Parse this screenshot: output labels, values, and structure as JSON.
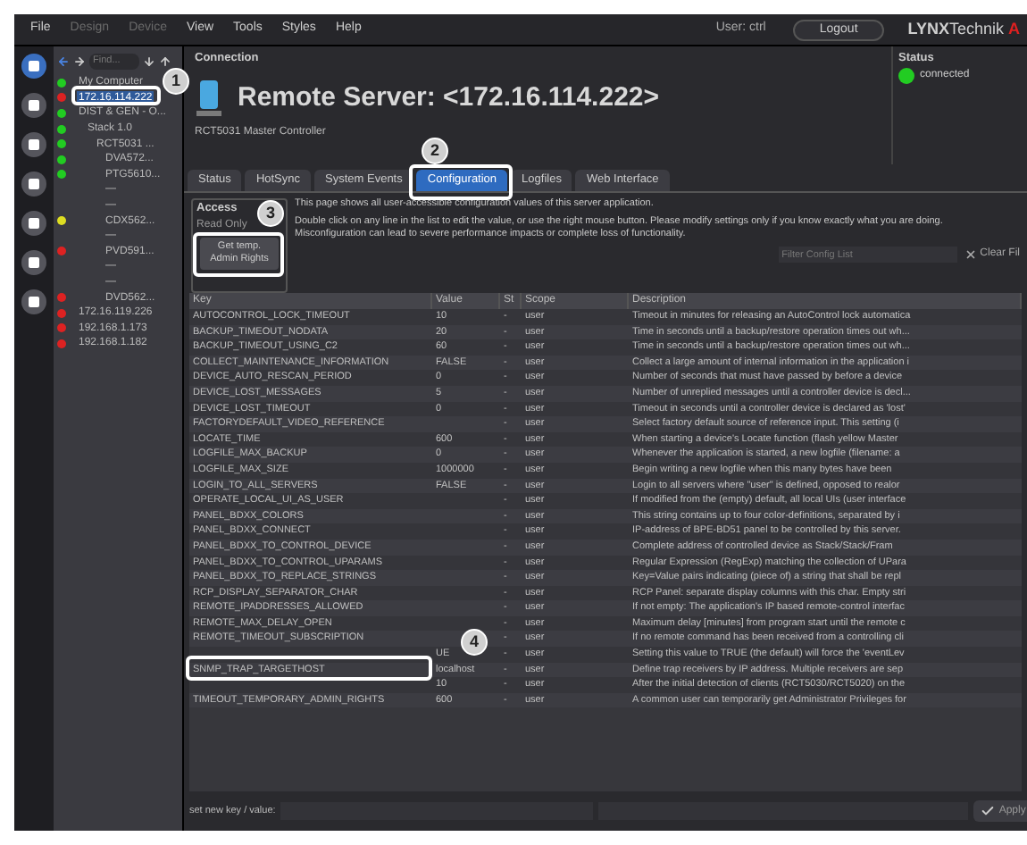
{
  "menu": [
    {
      "label": "File",
      "disabled": false
    },
    {
      "label": "Design",
      "disabled": true
    },
    {
      "label": "Device",
      "disabled": true
    },
    {
      "label": "View",
      "disabled": false
    },
    {
      "label": "Tools",
      "disabled": false
    },
    {
      "label": "Styles",
      "disabled": false
    },
    {
      "label": "Help",
      "disabled": false
    }
  ],
  "user": "User: ctrl",
  "logout": "Logout",
  "logo": {
    "bold": "LYNX",
    "rest": "Technik",
    "mark": "A"
  },
  "tree_nav": {
    "placeholder": "Find..."
  },
  "tree": [
    {
      "label": "My Computer",
      "color": "#22cc22",
      "selected": false
    },
    {
      "label": "172.16.114.222",
      "color": "#dd2222",
      "selected": true
    },
    {
      "label": "DIST & GEN - O...",
      "color": "#22cc22",
      "selected": false,
      "children": [
        {
          "label": "Stack 1.0",
          "color": "#22cc22",
          "selected": false,
          "children": [
            {
              "label": "RCT5031 ...",
              "color": "#22cc22",
              "selected": false,
              "children": [
                {
                  "label": "DVA572...",
                  "color": "#22cc22",
                  "selected": false
                },
                {
                  "label": "PTG5610...",
                  "color": "#22cc22",
                  "selected": false
                },
                {
                  "label": "—",
                  "selected": false
                },
                {
                  "label": "—",
                  "selected": false
                },
                {
                  "label": "CDX562...",
                  "color": "#dddd22",
                  "selected": false
                },
                {
                  "label": "—",
                  "selected": false
                },
                {
                  "label": "PVD591...",
                  "color": "#dd2222",
                  "selected": false
                },
                {
                  "label": "—",
                  "selected": false
                },
                {
                  "label": "—",
                  "selected": false
                },
                {
                  "label": "DVD562...",
                  "color": "#dd2222",
                  "selected": false
                }
              ]
            }
          ]
        }
      ]
    },
    {
      "label": "172.16.119.226",
      "color": "#dd2222",
      "selected": false
    },
    {
      "label": "192.168.1.173",
      "color": "#dd2222",
      "selected": false
    },
    {
      "label": "192.168.1.182",
      "color": "#dd2222",
      "selected": false
    }
  ],
  "connection": {
    "legend": "Connection",
    "title": "Remote Server: <172.16.114.222>",
    "subtitle": "RCT5031 Master Controller"
  },
  "status": {
    "legend": "Status",
    "text": "connected",
    "color": "#22cc22"
  },
  "tabs": [
    {
      "label": "Status",
      "selected": false
    },
    {
      "label": "HotSync",
      "selected": false
    },
    {
      "label": "System Events",
      "selected": false
    },
    {
      "label": "Configuration",
      "selected": true
    },
    {
      "label": "Logfiles",
      "selected": false
    },
    {
      "label": "Web Interface",
      "selected": false
    }
  ],
  "access": {
    "legend": "Access",
    "mode": "Read Only",
    "button": "Get temp. Admin Rights"
  },
  "info": [
    "This page shows all user-accessible configuration values of this server application.",
    "Double click on any line in the list to edit the value, or use the right mouse button. Please modify settings only if you know exactly what you are doing. Misconfiguration can lead to severe performance impacts or complete loss of functionality."
  ],
  "filter": {
    "placeholder": "Filter Config List",
    "clear": "Clear Fil"
  },
  "table": {
    "columns": [
      "Key",
      "Value",
      "St",
      "Scope",
      "Description"
    ],
    "rows": [
      {
        "key": "AUTOCONTROL_LOCK_TIMEOUT",
        "value": "10",
        "st": "-",
        "scope": "user",
        "desc": "Timeout in minutes for releasing an AutoControl lock automatica"
      },
      {
        "key": "BACKUP_TIMEOUT_NODATA",
        "value": "20",
        "st": "-",
        "scope": "user",
        "desc": "Time in seconds until a backup/restore operation times out wh..."
      },
      {
        "key": "BACKUP_TIMEOUT_USING_C2",
        "value": "60",
        "st": "-",
        "scope": "user",
        "desc": "Time in seconds until a backup/restore operation times out wh..."
      },
      {
        "key": "COLLECT_MAINTENANCE_INFORMATION",
        "value": "FALSE",
        "st": "-",
        "scope": "user",
        "desc": "Collect a large amount of internal information in the application i"
      },
      {
        "key": "DEVICE_AUTO_RESCAN_PERIOD",
        "value": "0",
        "st": "-",
        "scope": "user",
        "desc": "Number of seconds that must have passed by before a device"
      },
      {
        "key": "DEVICE_LOST_MESSAGES",
        "value": "5",
        "st": "-",
        "scope": "user",
        "desc": "Number of unreplied messages until a controller device is decl..."
      },
      {
        "key": "DEVICE_LOST_TIMEOUT",
        "value": "0",
        "st": "-",
        "scope": "user",
        "desc": "Timeout in seconds until a controller device is declared as 'lost'"
      },
      {
        "key": "FACTORYDEFAULT_VIDEO_REFERENCE",
        "st": "-",
        "scope": "user",
        "desc": "Select factory default source of reference input. This setting (i"
      },
      {
        "key": "LOCATE_TIME",
        "value": "600",
        "st": "-",
        "scope": "user",
        "desc": "When starting a device's Locate function (flash yellow Master"
      },
      {
        "key": "LOGFILE_MAX_BACKUP",
        "value": "0",
        "st": "-",
        "scope": "user",
        "desc": "Whenever the application is started, a new logfile (filename: a"
      },
      {
        "key": "LOGFILE_MAX_SIZE",
        "value": "1000000",
        "st": "-",
        "scope": "user",
        "desc": "Begin writing a new logfile when this many bytes have been"
      },
      {
        "key": "LOGIN_TO_ALL_SERVERS",
        "value": "FALSE",
        "st": "-",
        "scope": "user",
        "desc": "Login to all servers where \"user\" is defined, opposed to realor"
      },
      {
        "key": "OPERATE_LOCAL_UI_AS_USER",
        "st": "-",
        "scope": "user",
        "desc": "If modified from the (empty) default, all local UIs (user interface"
      },
      {
        "key": "PANEL_BDXX_COLORS",
        "st": "-",
        "scope": "user",
        "desc": "This string contains up to four color-definitions, separated by i"
      },
      {
        "key": "PANEL_BDXX_CONNECT",
        "st": "-",
        "scope": "user",
        "desc": "IP-address of BPE-BD51 panel to be controlled by this server."
      },
      {
        "key": "PANEL_BDXX_TO_CONTROL_DEVICE",
        "st": "-",
        "scope": "user",
        "desc": "Complete address of controlled device as Stack/Stack/Fram"
      },
      {
        "key": "PANEL_BDXX_TO_CONTROL_UPARAMS",
        "st": "-",
        "scope": "user",
        "desc": "Regular Expression (RegExp) matching the collection of UPara"
      },
      {
        "key": "PANEL_BDXX_TO_REPLACE_STRINGS",
        "st": "-",
        "scope": "user",
        "desc": "Key=Value pairs indicating (piece of) a string that shall be repl"
      },
      {
        "key": "RCP_DISPLAY_SEPARATOR_CHAR",
        "st": "-",
        "scope": "user",
        "desc": "RCP Panel: separate display columns with this char. Empty stri"
      },
      {
        "key": "REMOTE_IPADDRESSES_ALLOWED",
        "st": "-",
        "scope": "user",
        "desc": "If not empty: The application's IP based remote-control interfac"
      },
      {
        "key": "REMOTE_MAX_DELAY_OPEN",
        "st": "-",
        "scope": "user",
        "desc": "Maximum delay [minutes] from program start until the remote c"
      },
      {
        "key": "REMOTE_TIMEOUT_SUBSCRIPTION",
        "st": "-",
        "scope": "user",
        "desc": "If no remote command has been received from a controlling cli"
      },
      {
        "value": "UE",
        "st": "-",
        "scope": "user",
        "desc": "Setting this value to TRUE (the default) will force the 'eventLev"
      },
      {
        "key": "SNMP_TRAP_TARGETHOST",
        "value": "localhost",
        "st": "-",
        "scope": "user",
        "desc": "Define trap receivers by IP address. Multiple receivers are sep"
      },
      {
        "value": "10",
        "st": "-",
        "scope": "user",
        "desc": "After the initial detection of clients (RCT5030/RCT5020) on the"
      },
      {
        "key": "TIMEOUT_TEMPORARY_ADMIN_RIGHTS",
        "value": "600",
        "st": "-",
        "scope": "user",
        "desc": "A common user can temporarily get Administrator Privileges for"
      }
    ]
  },
  "bottom": {
    "label": "set new key / value:",
    "apply": "Apply"
  },
  "callouts": [
    {
      "number": "1"
    },
    {
      "number": "2"
    },
    {
      "number": "3"
    },
    {
      "number": "4"
    }
  ]
}
